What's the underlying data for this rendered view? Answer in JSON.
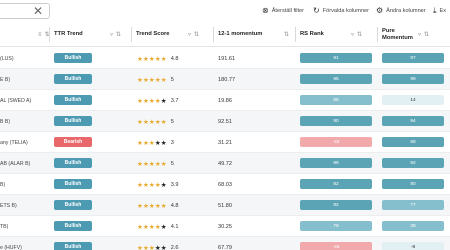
{
  "toolbar": {
    "reset_label": "Återställ filter",
    "default_columns_label": "Förvalda kolumner",
    "change_columns_label": "Ändra kolumner",
    "export_label": "Ex"
  },
  "columns": {
    "ttr_trend": "TTR Trend",
    "trend_score": "Trend Score",
    "momentum": "12-1 momentum",
    "rs_rank": "RS Rank",
    "pure_momentum": [
      "Pure",
      "Momentum"
    ]
  },
  "colors": {
    "bullish": "#4d9ab3",
    "bearish": "#e8686b",
    "rank_strong": "#5aa4b5",
    "rank_medium": "#85bfcd",
    "rank_light": "#e3f0f3",
    "rank_negative": "#f2a9ab",
    "star_on": "#e8a92f"
  },
  "rows": [
    {
      "name": "(LUS)",
      "trend": "Bullish",
      "trend_type": "bullish",
      "stars_on": 5,
      "stars_off": 0,
      "score": "4.8",
      "momentum": "191.61",
      "rs": "91",
      "rs_type": "strong",
      "pm": "97",
      "pm_type": "strong"
    },
    {
      "name": "E B)",
      "trend": "Bullish",
      "trend_type": "bullish",
      "stars_on": 5,
      "stars_off": 0,
      "score": "5",
      "momentum": "180.77",
      "rs": "95",
      "rs_type": "strong",
      "pm": "99",
      "pm_type": "strong"
    },
    {
      "name": "AL (SWED A)",
      "trend": "Bullish",
      "trend_type": "bullish",
      "stars_on": 4,
      "stars_off": 1,
      "score": "3.7",
      "momentum": "19.86",
      "rs": "65",
      "rs_type": "medium",
      "pm": "14",
      "pm_type": "light"
    },
    {
      "name": "B B)",
      "trend": "Bullish",
      "trend_type": "bullish",
      "stars_on": 5,
      "stars_off": 0,
      "score": "5",
      "momentum": "92.51",
      "rs": "90",
      "rs_type": "strong",
      "pm": "94",
      "pm_type": "strong"
    },
    {
      "name": "any (TELIA)",
      "trend": "Bearish",
      "trend_type": "bearish",
      "stars_on": 3,
      "stars_off": 2,
      "score": "3",
      "momentum": "31.21",
      "rs": "-46",
      "rs_type": "negative",
      "pm": "68",
      "pm_type": "strong"
    },
    {
      "name": "AB (ALAR B)",
      "trend": "Bullish",
      "trend_type": "bullish",
      "stars_on": 5,
      "stars_off": 0,
      "score": "5",
      "momentum": "49.72",
      "rs": "89",
      "rs_type": "strong",
      "pm": "92",
      "pm_type": "strong"
    },
    {
      "name": "B)",
      "trend": "Bullish",
      "trend_type": "bullish",
      "stars_on": 4,
      "stars_off": 1,
      "score": "3.9",
      "momentum": "68.03",
      "rs": "82",
      "rs_type": "strong",
      "pm": "80",
      "pm_type": "strong"
    },
    {
      "name": "ETS B)",
      "trend": "Bullish",
      "trend_type": "bullish",
      "stars_on": 5,
      "stars_off": 0,
      "score": "4.8",
      "momentum": "51.80",
      "rs": "82",
      "rs_type": "strong",
      "pm": "77",
      "pm_type": "medium"
    },
    {
      "name": "TB)",
      "trend": "Bullish",
      "trend_type": "bullish",
      "stars_on": 4,
      "stars_off": 1,
      "score": "4.1",
      "momentum": "30.25",
      "rs": "76",
      "rs_type": "medium",
      "pm": "38",
      "pm_type": "medium"
    },
    {
      "name": "e (HUFV)",
      "trend": "Bullish",
      "trend_type": "bullish",
      "stars_on": 3,
      "stars_off": 2,
      "score": "2.6",
      "momentum": "67.79",
      "rs": "-46",
      "rs_type": "negative",
      "pm": "-8",
      "pm_type": "light"
    }
  ]
}
